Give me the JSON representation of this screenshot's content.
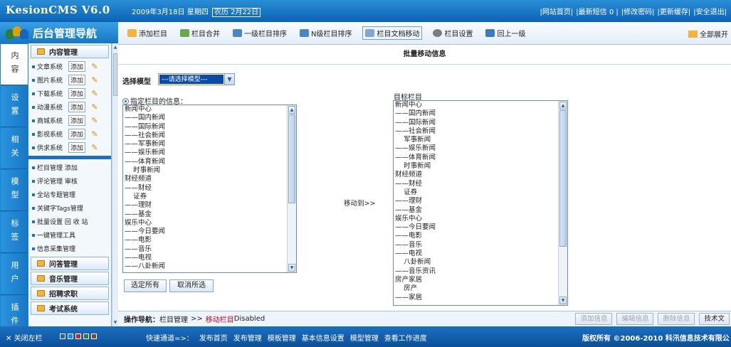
{
  "header": {
    "app_title": "KesionCMS V6.0",
    "date_prefix": "2009年3月18日 星期四",
    "date_highlight": "农历 2月22日",
    "links": [
      "|网站首页|",
      "|最新短信 0 |",
      "|修改密码|",
      "|更新缓存|",
      "|安全退出|"
    ]
  },
  "sidebar": {
    "title": "后台管理导航",
    "tabs": [
      "内容",
      "设置",
      "相关",
      "模型",
      "标签",
      "用户",
      "插件"
    ],
    "section_content": "内容管理",
    "systems": [
      {
        "name": "文章系统",
        "add": "添加"
      },
      {
        "name": "图片系统",
        "add": "添加"
      },
      {
        "name": "下载系统",
        "add": "添加"
      },
      {
        "name": "动漫系统",
        "add": "添加"
      },
      {
        "name": "商城系统",
        "add": "添加"
      },
      {
        "name": "影视系统",
        "add": "添加"
      },
      {
        "name": "供求系统",
        "add": "添加"
      }
    ],
    "plain_items": [
      "栏目管理 添加",
      "评论管理 审核",
      "全站专题管理",
      "关键字Tags管理",
      "批量设置 回 收 站",
      "一键管理工具",
      "信息采集管理"
    ],
    "sections_bottom": [
      "问答管理",
      "音乐管理",
      "招聘求职",
      "考试系统"
    ]
  },
  "toolbar": {
    "items": [
      "添加栏目",
      "栏目合并",
      "一级栏目排序",
      "N级栏目排序",
      "栏目文档移动",
      "栏目设置",
      "回上一级"
    ],
    "active_index": 4,
    "right": "全部展开"
  },
  "content": {
    "page_title": "批量移动信息",
    "model_label": "选择模型",
    "model_value": "---请选择模型---",
    "source_label": "指定栏目的信息：",
    "target_label": "目标栏目",
    "move_label": "移动到>>",
    "source_items": [
      "新闻中心",
      "——国内新闻",
      "——国际新闻",
      "——社会新闻",
      "——军事新闻",
      "——娱乐新闻",
      "——体育新闻",
      "    时事新闻",
      "财经频道",
      "——财经",
      "    证券",
      "——理财",
      "——基金",
      "娱乐中心",
      "——今日要闻",
      "——电影",
      "——音乐",
      "——电视",
      "——八卦新闻"
    ],
    "target_items": [
      "新闻中心",
      "——国内新闻",
      "——国际新闻",
      "——社会新闻",
      "    军事新闻",
      "——娱乐新闻",
      "——体育新闻",
      "    时事新闻",
      "财经频道",
      "——财经",
      "    证券",
      "——理财",
      "——基金",
      "娱乐中心",
      "——今日要闻",
      "——电影",
      "——音乐",
      "——电视",
      "    八卦新闻",
      "——音乐资讯",
      "房产家居",
      "    房产",
      "——家居"
    ],
    "select_all": "选定所有",
    "cancel_all": "取消所选"
  },
  "navbar": {
    "label": "操作导航：",
    "crumb1": "栏目管理",
    "sep": ">>",
    "crumb2": "移动栏目",
    "tail": "Disabled",
    "buttons": [
      "添加信息",
      "编辑信息",
      "删除信息",
      "技术文"
    ]
  },
  "footer": {
    "close": "关闭左栏",
    "quick_label": "快速通道=>：",
    "quick": [
      "发布首页",
      "发布管理",
      "模板管理",
      "基本信息设置",
      "模型管理",
      "查看工作进度"
    ],
    "copyright": "版权所有 ©2006-2010 科汛信息技术有限公"
  },
  "colors": {
    "accent": "#1577c6",
    "highlight": "#d0021b",
    "select_bg": "#0b4aa6"
  }
}
